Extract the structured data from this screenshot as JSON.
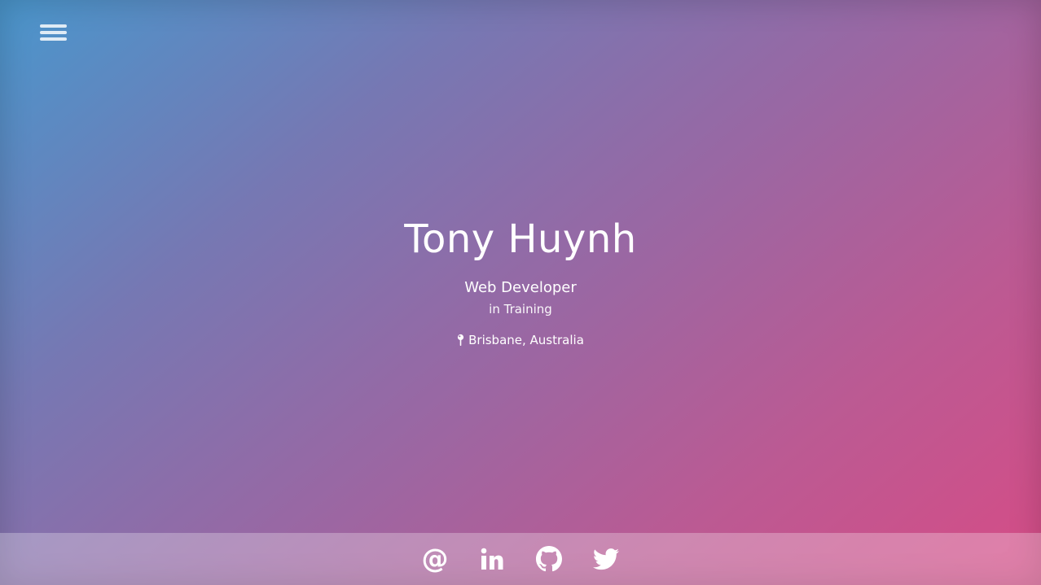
{
  "profile": {
    "name": "Tony Huynh",
    "role": "Web Developer",
    "sub_role": "in Training",
    "location": "Brisbane, Australia"
  },
  "icons": {
    "menu": "hamburger-menu-icon",
    "location": "map-pin-icon",
    "email": "at-sign-icon",
    "linkedin": "linkedin-icon",
    "github": "github-icon",
    "twitter": "twitter-icon"
  },
  "social": {
    "email_glyph": "@"
  },
  "colors": {
    "gradient_start": "#4a96cc",
    "gradient_end": "#d64c86",
    "text": "#ffffff"
  }
}
